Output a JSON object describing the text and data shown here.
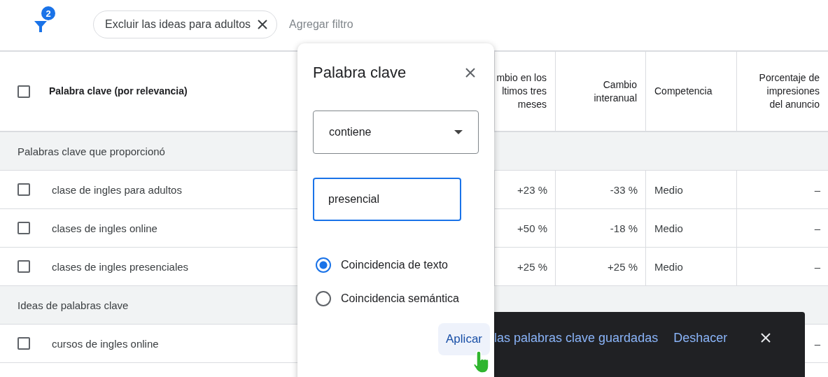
{
  "filter_bar": {
    "badge": "2",
    "chips": [
      {
        "label": "Excluir las ideas para adultos",
        "kind": "removable"
      }
    ],
    "add_filter": "Agregar filtro"
  },
  "table": {
    "header": {
      "checked": false,
      "keyword": "Palabra clave (por relevancia)",
      "columns": [
        [
          "mbio en los",
          "ltimos tres",
          "meses"
        ],
        [
          "Cambio",
          "interanual"
        ],
        [
          "Competencia"
        ],
        [
          "Porcentaje de",
          "impresiones",
          "del anuncio"
        ]
      ]
    },
    "sections": [
      {
        "title": "Palabras clave que proporcionó",
        "rows": [
          {
            "keyword": "clase de ingles para adultos",
            "checked": false,
            "change_3m": "+23 %",
            "yoy": "-33 %",
            "competition": "Medio",
            "impression_share": "–"
          },
          {
            "keyword": "clases de ingles online",
            "checked": false,
            "change_3m": "+50 %",
            "yoy": "-18 %",
            "competition": "Medio",
            "impression_share": "–"
          },
          {
            "keyword": "clases de ingles presenciales",
            "checked": false,
            "change_3m": "+25 %",
            "yoy": "+25 %",
            "competition": "Medio",
            "impression_share": "–"
          }
        ]
      },
      {
        "title": "Ideas de palabras clave",
        "rows": [
          {
            "keyword": "cursos de ingles online",
            "checked": false,
            "impression_share": "–"
          }
        ]
      }
    ]
  },
  "popup": {
    "title": "Palabra clave",
    "operator": "contiene",
    "value": "presencial",
    "options": [
      {
        "label": "Coincidencia de texto",
        "selected": true
      },
      {
        "label": "Coincidencia semántica",
        "selected": false
      }
    ],
    "apply": "Aplicar"
  },
  "snackbar": {
    "message": "las palabras clave guardadas",
    "action": "Deshacer"
  }
}
